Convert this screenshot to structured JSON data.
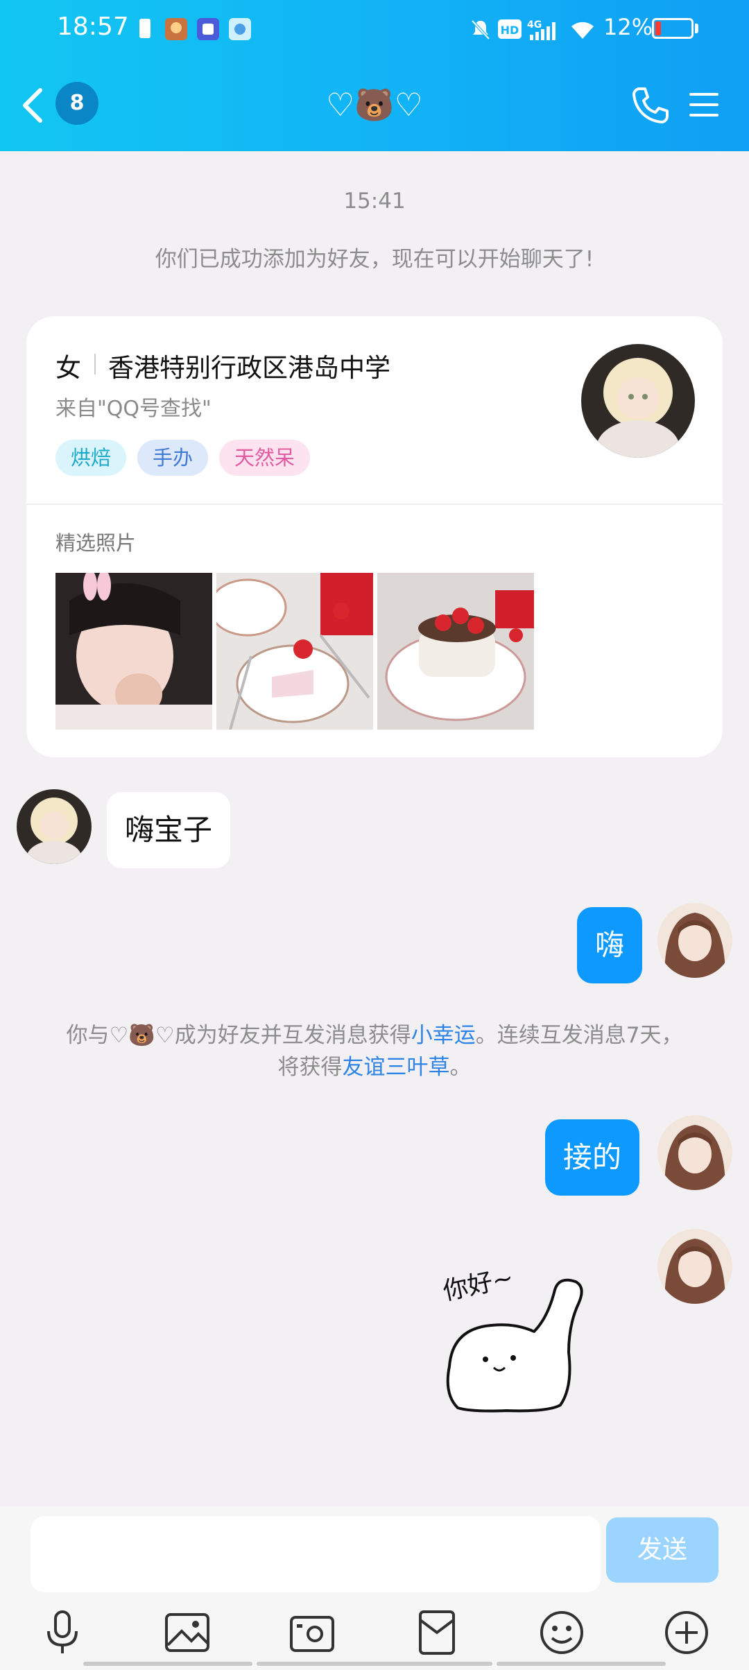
{
  "status": {
    "time": "18:57",
    "battery_pct": "12%",
    "signal": "4G",
    "hd": "HD"
  },
  "header": {
    "unread_count": "8",
    "title": "♡🐻♡"
  },
  "chat": {
    "timestamp": "15:41",
    "system_added": "你们已成功添加为好友，现在可以开始聊天了!",
    "profile_card": {
      "gender": "女",
      "school": "香港特别行政区港岛中学",
      "source": "来自\"QQ号查找\"",
      "tags": [
        "烘焙",
        "手办",
        "天然呆"
      ],
      "photos_label": "精选照片"
    },
    "messages": [
      {
        "side": "left",
        "text": "嗨宝子"
      },
      {
        "side": "right",
        "text": "嗨"
      },
      {
        "side": "right",
        "text": "接的"
      }
    ],
    "system_luck": {
      "part1": "你与♡🐻♡成为好友并互发消息获得",
      "link1": "小幸运",
      "part2": "。连续互发消息7天，",
      "part3": "将获得",
      "link2": "友谊三叶草",
      "part4": "。"
    },
    "sticker_text": "你好~"
  },
  "input": {
    "send_label": "发送"
  },
  "colors": {
    "accent": "#0d99ff",
    "header_gradient_start": "#12c6f2",
    "header_gradient_end": "#0f9ff4",
    "link": "#2d84e5"
  },
  "icons": [
    "back-icon",
    "phone-icon",
    "menu-icon",
    "mic-icon",
    "image-icon",
    "camera-icon",
    "red-packet-icon",
    "emoji-icon",
    "plus-icon"
  ]
}
